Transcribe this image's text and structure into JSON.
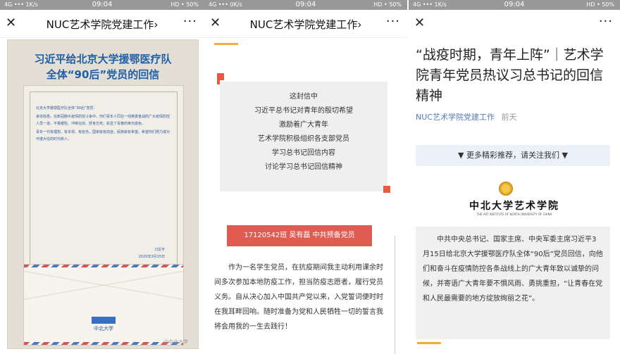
{
  "status": {
    "left": [
      "4G ••• 1K/s",
      "4G ••• 0K/s",
      "4G ••• 1K/s"
    ],
    "time": "09:04",
    "right": [
      "HD • 50%",
      "HD • 50%",
      "HD • 50%"
    ]
  },
  "nav": {
    "close": "✕",
    "more": "···",
    "title": "NUC艺术学院党建工作›"
  },
  "phone1": {
    "poster_title_1": "习近平给北京大学援鄂医疗队",
    "poster_title_2": "全体“90后”党员的回信",
    "letter_salutation": "北京大学援鄂医疗队全体“90后”党员：",
    "letter_p1": "来信收悉。在新冠肺炎疫情防控斗争中，你们青年人同在一线英勇奋战的广大疫情防控人员一道，不畏艰险、冲锋在前、舒身忘死，彰显了青春的荣光底色。",
    "letter_p2": "青年一代有理想、有本领、有担当，国家就有前途，民族就有希望。希望你们努力成为可堪大任的时代新人。",
    "letter_sign": "习近平",
    "letter_date": "2020年3月15日",
    "envelope_logo": "中北大学",
    "watermark": "@中北大学"
  },
  "phone2": {
    "lines": [
      "这封信中",
      "习近平总书记对青年的殷切希望",
      "激励着广大青年",
      "艺术学院积极组织各支部党员",
      "学习总书记回信内容",
      "讨论学习总书记回信精神"
    ],
    "banner": "17120542班 吴有磊 中共预备党员",
    "body": "作为一名学生党员，在抗疫期间我主动利用课余时间多次参加本地防疫工作，担当防疫志愿者，履行党员义务。自从决心加入中国共产党以来，入党誓词便时时在我耳畔回响。随时准备为党和人民牺牲一切的誓言我将会用我的一生去践行！"
  },
  "phone3": {
    "title": "“战疫时期，青年上阵”｜艺术学院青年党员热议习总书记的回信精神",
    "author": "NUC艺术学院党建工作",
    "date": "前天",
    "recommend": "▼  更多精彩推荐，请关注我们  ▼",
    "school_name": "中北大学艺术学院",
    "school_en": "THE ART INSTITUTE OF NORTH UNIVERSITY OF CHINA",
    "summary": "中共中央总书记、国家主席、中央军委主席习近平3月15日给北京大学援鄂医疗队全体“90后”党员回信，向他们和奋斗在疫情防控各条战线上的广大青年致以诚挚的问候，并寄语广大青年要不惧风雨、勇挑重担，“让青春在党和人民最需要的地方绽放绚丽之花”。"
  }
}
